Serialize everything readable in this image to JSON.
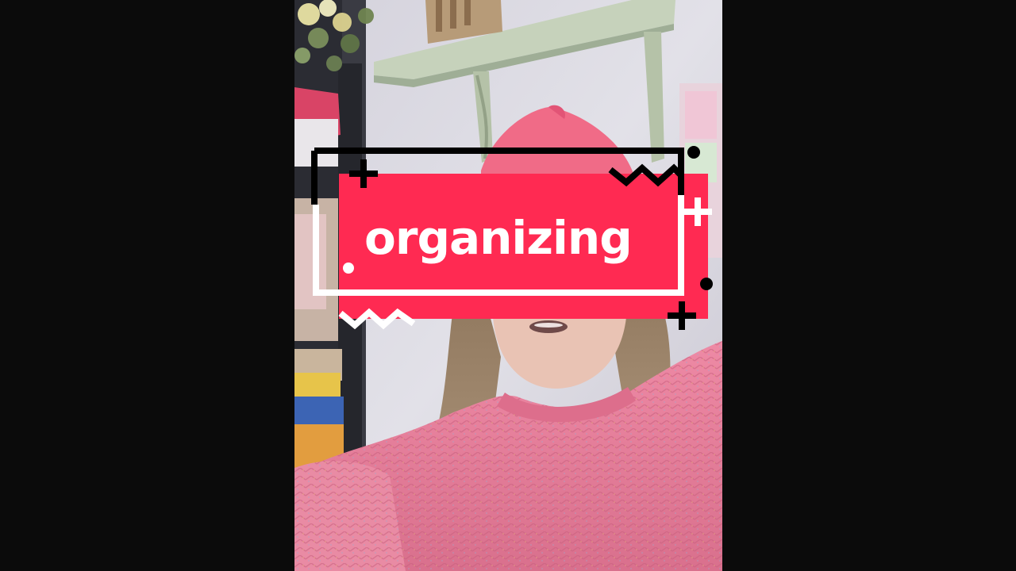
{
  "caption": {
    "text": "organizing"
  },
  "colors": {
    "letterbox": "#0b0b0b",
    "banner": "#ff2a52",
    "sweater": "#e87a97",
    "beanie": "#f26a86",
    "wall": "#dcdbe3",
    "shelf": "#bfcdb3"
  },
  "icons": [
    "plus-icon",
    "dot-icon",
    "zigzag-icon"
  ]
}
